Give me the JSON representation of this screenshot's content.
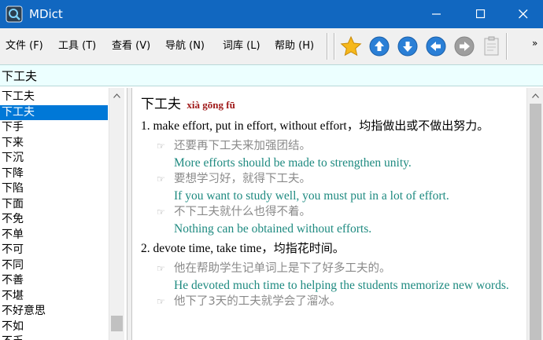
{
  "window": {
    "title": "MDict"
  },
  "menu": [
    {
      "label": "文件 (F)"
    },
    {
      "label": "工具 (T)"
    },
    {
      "label": "查看 (V)"
    },
    {
      "label": "导航 (N)"
    },
    {
      "label": "词库 (L)"
    },
    {
      "label": "帮助 (H)"
    }
  ],
  "toolbar": {
    "icons": [
      "star-icon",
      "up-arrow-icon",
      "down-arrow-icon",
      "back-arrow-icon",
      "forward-arrow-icon",
      "clipboard-icon"
    ],
    "colors": {
      "star": "#f6b81c",
      "arrow": "#2a7fd6",
      "disabled": "#9e9e9e"
    }
  },
  "query": {
    "value": "下工夫"
  },
  "wordlist": {
    "items": [
      "下工夫",
      "下工夫",
      "下手",
      "下来",
      "下沉",
      "下降",
      "下陷",
      "下面",
      "不免",
      "不单",
      "不可",
      "不同",
      "不善",
      "不堪",
      "不好意思",
      "不如",
      "不乏"
    ],
    "selected_index": 1
  },
  "entry": {
    "headword": "下工夫",
    "pinyin": "xià gōng fū",
    "senses": [
      {
        "number": "1.",
        "en": "make effort, put in effort, without effort，",
        "cn": "均指做出或不做出努力。",
        "examples": [
          {
            "cn": "还要再下工夫来加强团结。",
            "en": "More efforts should be made to strengthen unity."
          },
          {
            "cn": "要想学习好，就得下工夫。",
            "en": "If you want to study well, you must put in a lot of effort."
          },
          {
            "cn": "不下工夫就什么也得不着。",
            "en": "Nothing can be obtained without efforts."
          }
        ]
      },
      {
        "number": "2.",
        "en": "devote time, take time，",
        "cn": "均指花时间。",
        "examples": [
          {
            "cn": "他在帮助学生记单词上是下了好多工夫的。",
            "en": "He devoted much time to helping the students memorize new words."
          },
          {
            "cn": "他下了3天的工夫就学会了溜冰。",
            "en": ""
          }
        ]
      }
    ],
    "colors": {
      "pinyin": "#a01a1a",
      "example_cn": "#8a8a8a",
      "example_en": "#1e8a80"
    }
  }
}
